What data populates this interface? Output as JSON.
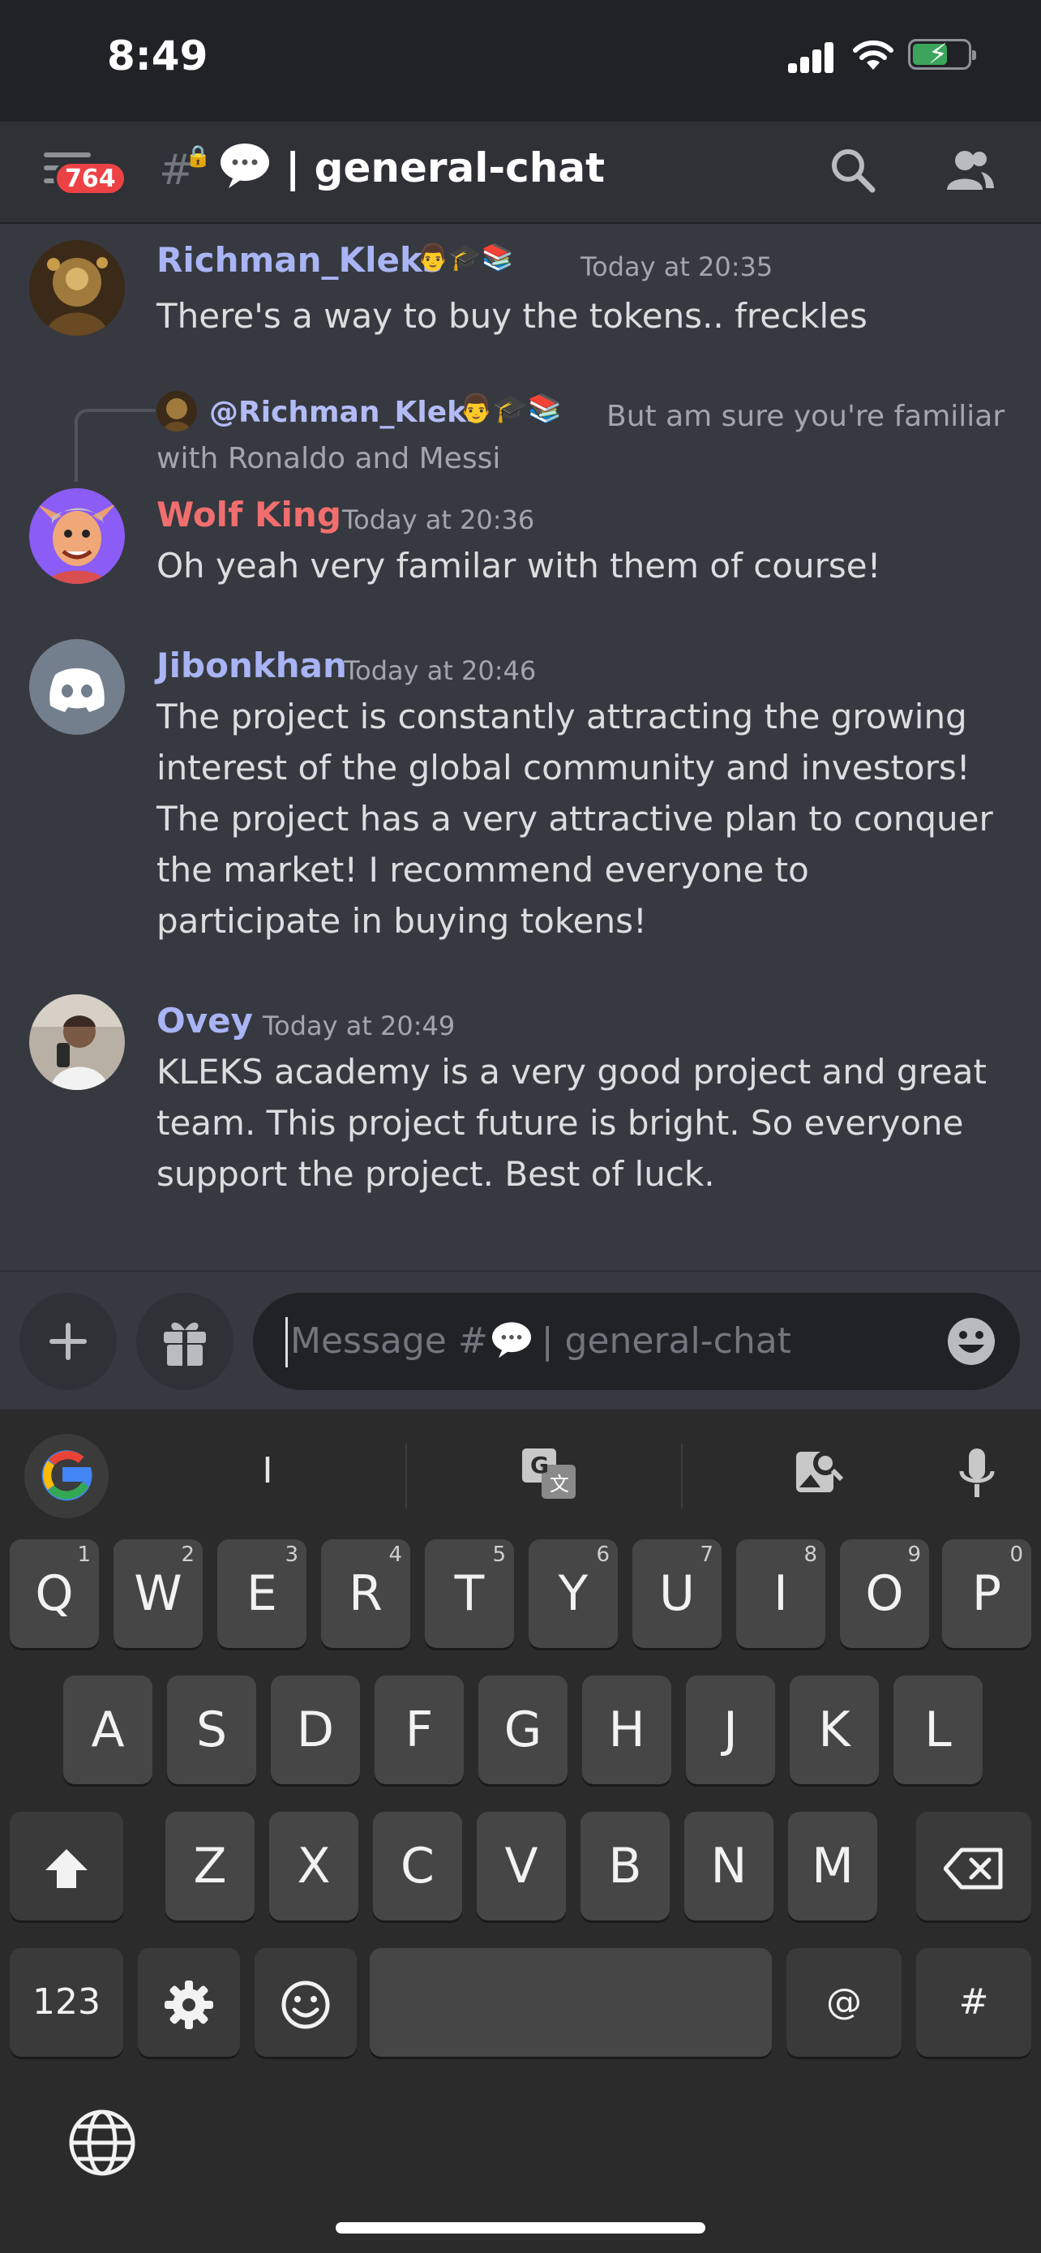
{
  "status_bar": {
    "time": "8:49"
  },
  "header": {
    "unread_badge": "764",
    "channel_hash": "#",
    "channel_name": "| general-chat"
  },
  "messages": [
    {
      "username": "Richman_Kleks",
      "user_color": "#a9b4f5",
      "badges": "👨🎓📚",
      "timestamp": "Today at 20:35",
      "text": "There's a way to buy the tokens.. freckles"
    },
    {
      "reply": {
        "mention": "@Richman_Kleks",
        "badges": "👨🎓📚",
        "text": "But am sure you're familiar with Ronaldo and Messi"
      },
      "username": "Wolf King",
      "user_color": "#f26e6e",
      "timestamp": "Today at 20:36",
      "text": "Oh yeah very familar with them of course!"
    },
    {
      "username": "Jibonkhan",
      "user_color": "#a9b4f5",
      "timestamp": "Today at 20:46",
      "text": "The project is constantly attracting the growing interest of the global community and investors! The project has a very attractive plan to conquer the market! I recommend everyone to participate in buying tokens!"
    },
    {
      "username": "Ovey",
      "user_color": "#a9b4f5",
      "timestamp": "Today at 20:49",
      "text": "KLEKS academy is a very good project and great team. This project future is bright. So everyone support the project. Best of luck."
    }
  ],
  "composer": {
    "placeholder_prefix": "Message #",
    "placeholder_suffix": "| general-chat"
  },
  "keyboard": {
    "suggestion": "I",
    "row1": [
      {
        "key": "Q",
        "num": "1"
      },
      {
        "key": "W",
        "num": "2"
      },
      {
        "key": "E",
        "num": "3"
      },
      {
        "key": "R",
        "num": "4"
      },
      {
        "key": "T",
        "num": "5"
      },
      {
        "key": "Y",
        "num": "6"
      },
      {
        "key": "U",
        "num": "7"
      },
      {
        "key": "I",
        "num": "8"
      },
      {
        "key": "O",
        "num": "9"
      },
      {
        "key": "P",
        "num": "0"
      }
    ],
    "row2": [
      "A",
      "S",
      "D",
      "F",
      "G",
      "H",
      "J",
      "K",
      "L"
    ],
    "row3": [
      "Z",
      "X",
      "C",
      "V",
      "B",
      "N",
      "M"
    ],
    "numbers_key": "123",
    "at_key": "@",
    "hash_key": "#"
  },
  "colors": {
    "background": "#36393f",
    "header": "#2f3136",
    "status_bar": "#202225",
    "badge": "#ed4245",
    "keyboard": "#2b2b2b"
  }
}
